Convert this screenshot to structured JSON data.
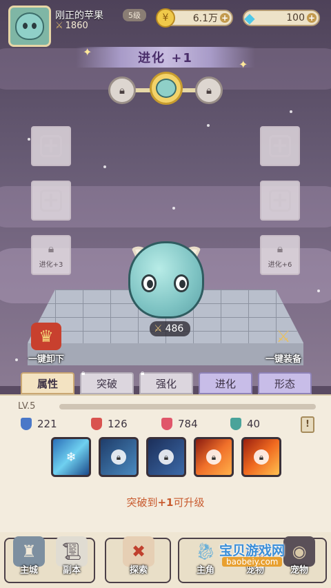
{
  "player": {
    "name": "刚正的苹果",
    "level": "5级",
    "power": "1860"
  },
  "resources": {
    "gold": "6.1万",
    "diamond": "100"
  },
  "evolution": {
    "title": "进化 +1"
  },
  "slots": {
    "left_locked_label": "进化+3",
    "right_locked_label": "进化+6"
  },
  "pet": {
    "power": "486"
  },
  "actions": {
    "unequip_all": "一键卸下",
    "equip_all": "一键装备"
  },
  "tabs": [
    {
      "label": "属性",
      "active": true,
      "locked": false
    },
    {
      "label": "突破",
      "active": false,
      "locked": true
    },
    {
      "label": "强化",
      "active": false,
      "locked": true
    },
    {
      "label": "进化",
      "active": false,
      "locked": false
    },
    {
      "label": "形态",
      "active": false,
      "locked": false
    }
  ],
  "panel": {
    "level": "LV.5",
    "stats": [
      {
        "icon": "attack-icon",
        "value": "221",
        "color": "#4a78c8"
      },
      {
        "icon": "crit-icon",
        "value": "126",
        "color": "#d9534f"
      },
      {
        "icon": "hp-icon",
        "value": "784",
        "color": "#e0566a"
      },
      {
        "icon": "defense-icon",
        "value": "40",
        "color": "#4aa39a"
      }
    ],
    "hint_prefix": "突破到",
    "hint_value": "+1",
    "hint_suffix": "可升级"
  },
  "nav": {
    "main_city": "主城",
    "dungeon": "副本",
    "explore": "探索",
    "hero": "主角",
    "pet_label": "宠物",
    "pet_behind": "宠物"
  },
  "watermark": {
    "title": "宝贝游戏网",
    "url": "baobeiy.com"
  }
}
